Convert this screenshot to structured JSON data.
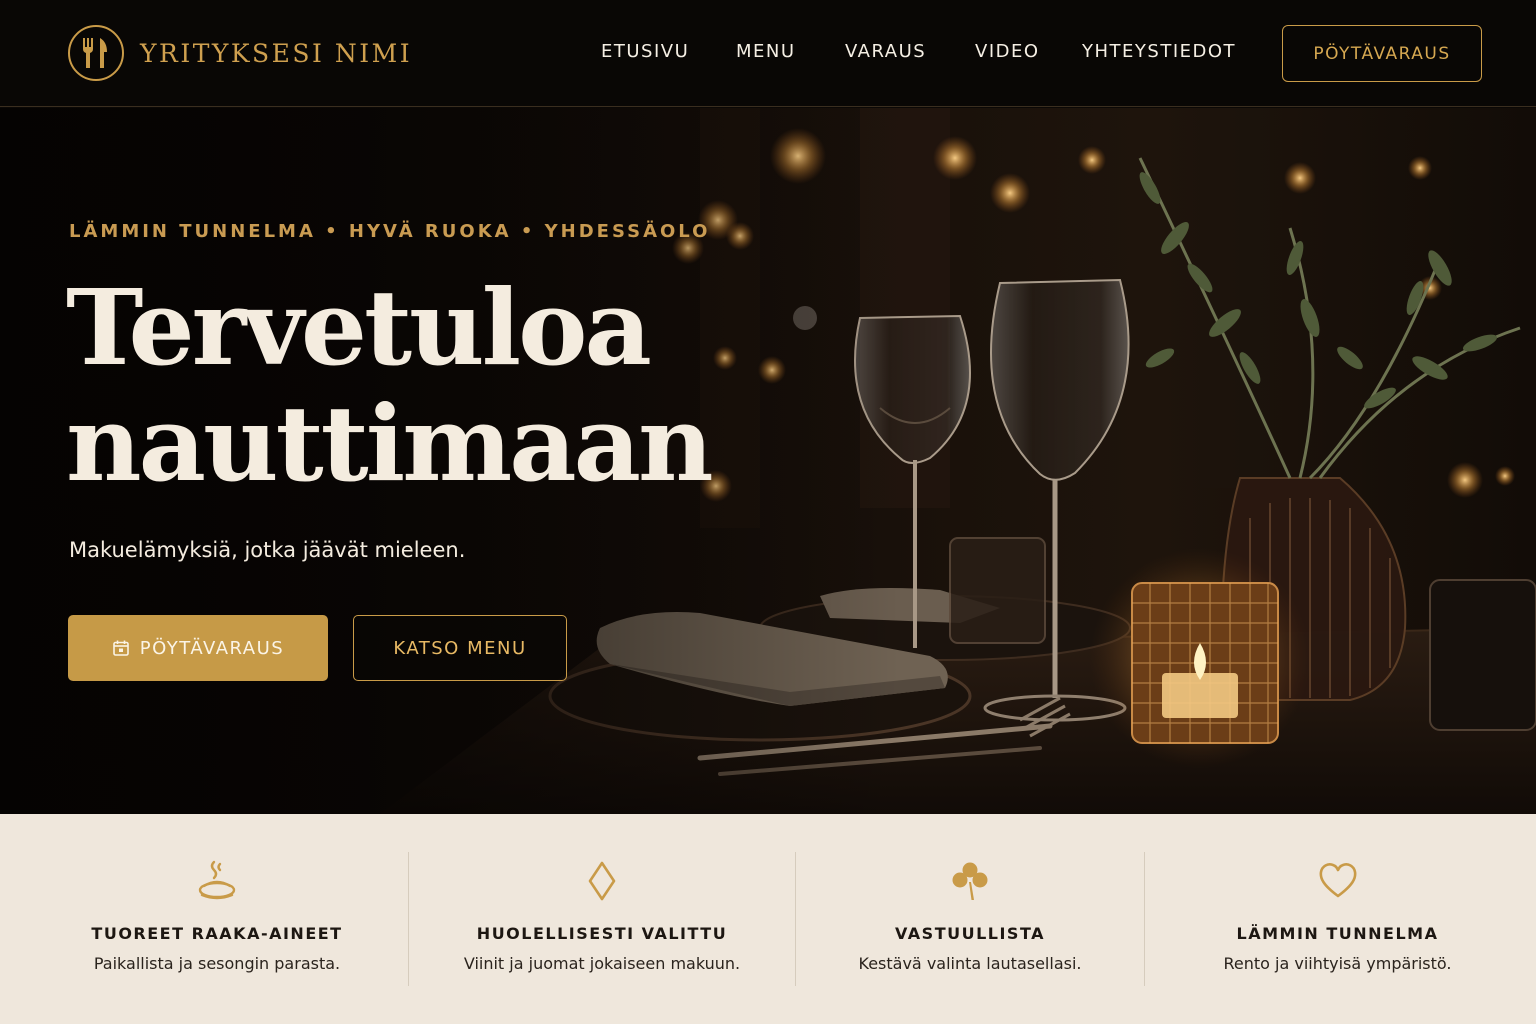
{
  "brand": {
    "name": "YRITYKSESI NIMI",
    "logo_icon": "fork-knife-icon"
  },
  "nav": {
    "items": [
      {
        "label": "ETUSIVU"
      },
      {
        "label": "MENU"
      },
      {
        "label": "VARAUS"
      },
      {
        "label": "VIDEO"
      },
      {
        "label": "YHTEYSTIEDOT"
      }
    ],
    "cta_label": "PÖYTÄVARAUS"
  },
  "hero": {
    "tagline": "LÄMMIN TUNNELMA • HYVÄ RUOKA • YHDESSÄOLO",
    "headline_line1": "Tervetuloa",
    "headline_line2": "nauttimaan",
    "subtitle": "Makuelämyksiä, jotka jäävät mieleen.",
    "primary_button": {
      "label": "PÖYTÄVARAUS",
      "icon": "calendar-icon"
    },
    "secondary_button": {
      "label": "KATSO MENU"
    }
  },
  "features": [
    {
      "icon": "hot-dish-icon",
      "title": "TUOREET RAAKA-AINEET",
      "text": "Paikallista ja sesongin parasta."
    },
    {
      "icon": "diamond-icon",
      "title": "HUOLELLISESTI VALITTU",
      "text": "Viinit ja juomat jokaiseen makuun."
    },
    {
      "icon": "clover-icon",
      "title": "VASTUULLISTA",
      "text": "Kestävä valinta lautasellasi."
    },
    {
      "icon": "heart-icon",
      "title": "LÄMMIN TUNNELMA",
      "text": "Rento ja viihtyisä ympäristö."
    }
  ],
  "colors": {
    "gold": "#c99b48",
    "dark": "#090705",
    "cream": "#efe7dc",
    "text_light": "#f4ecdf"
  }
}
